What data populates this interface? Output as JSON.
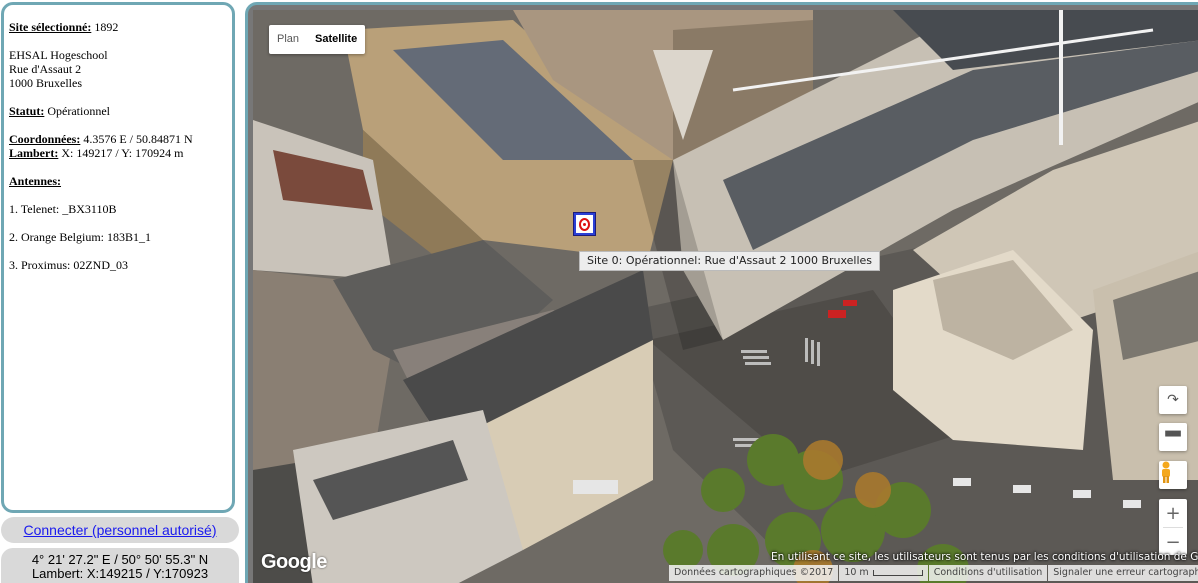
{
  "site": {
    "selected_label": "Site sélectionné:",
    "selected_value": "1892",
    "address": [
      "EHSAL Hogeschool",
      "Rue d'Assaut 2",
      "1000 Bruxelles"
    ],
    "status_label": "Statut:",
    "status_value": "Opérationnel",
    "coords_label": "Coordonnées:",
    "coords_value": "4.3576 E / 50.84871 N",
    "lambert_label": "Lambert:",
    "lambert_value": "X: 149217 / Y: 170924 m",
    "antennas_label": "Antennes:",
    "antennas": [
      "1. Telenet: _BX3110B",
      "2. Orange Belgium: 183B1_1",
      "3. Proximus: 02ZND_03"
    ]
  },
  "connect_label": "Connecter (personnel autorisé)",
  "cursor_coords": {
    "dms": "4° 21' 27.2\" E / 50° 50' 55.3\" N",
    "lambert": "Lambert: X:149215 / Y:170923"
  },
  "map": {
    "type_plan": "Plan",
    "type_satellite": "Satellite",
    "active_type": "Satellite",
    "tooltip": "Site 0: Opérationnel: Rue d'Assaut 2 1000 Bruxelles",
    "logo": "Google",
    "notice": "En utilisant ce site, les utilisateurs sont tenus par les conditions d'utilisation de Google.",
    "footer": {
      "data": "Données cartographiques ©2017",
      "scale": "10 m",
      "terms": "Conditions d'utilisation",
      "report": "Signaler une erreur cartographique"
    },
    "controls": {
      "rotate_icon": "rotate-icon",
      "tilt_icon": "tilt-icon",
      "pegman_icon": "pegman-icon",
      "zoom_in": "+",
      "zoom_out": "−"
    }
  },
  "colors": {
    "panel_border": "#6fa7b4",
    "button_bg": "#d9d9d9",
    "link": "#1a1aee",
    "marker": "#2a3fd6"
  }
}
